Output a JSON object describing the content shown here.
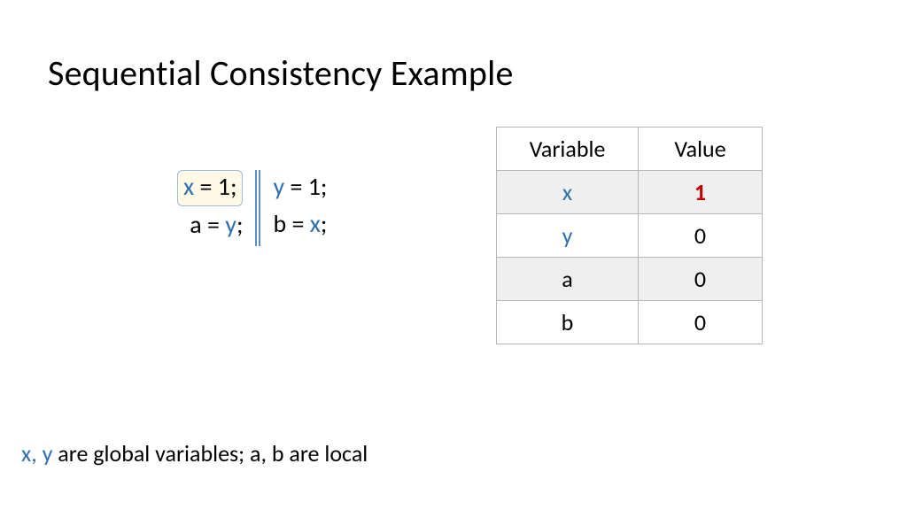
{
  "title": "Sequential Consistency Example",
  "code": {
    "left": {
      "line1": {
        "var": "x",
        "rest": " = 1;",
        "highlighted": true
      },
      "line2": {
        "lhs": "a = ",
        "rhsVar": "y",
        "tail": ";"
      }
    },
    "right": {
      "line1": {
        "var": "y",
        "rest": " = 1;"
      },
      "line2": {
        "lhs": "b = ",
        "rhsVar": "x",
        "tail": ";"
      }
    }
  },
  "table": {
    "headers": {
      "col1": "Variable",
      "col2": "Value"
    },
    "rows": [
      {
        "name": "x",
        "value": "1",
        "nameGlobal": true,
        "valueRed": true,
        "shade": true
      },
      {
        "name": "y",
        "value": "0",
        "nameGlobal": true,
        "valueRed": false,
        "shade": false
      },
      {
        "name": "a",
        "value": "0",
        "nameGlobal": false,
        "valueRed": false,
        "shade": true
      },
      {
        "name": "b",
        "value": "0",
        "nameGlobal": false,
        "valueRed": false,
        "shade": false
      }
    ]
  },
  "footer": {
    "globals": "x, y",
    "rest": " are global variables; a, b are local"
  }
}
